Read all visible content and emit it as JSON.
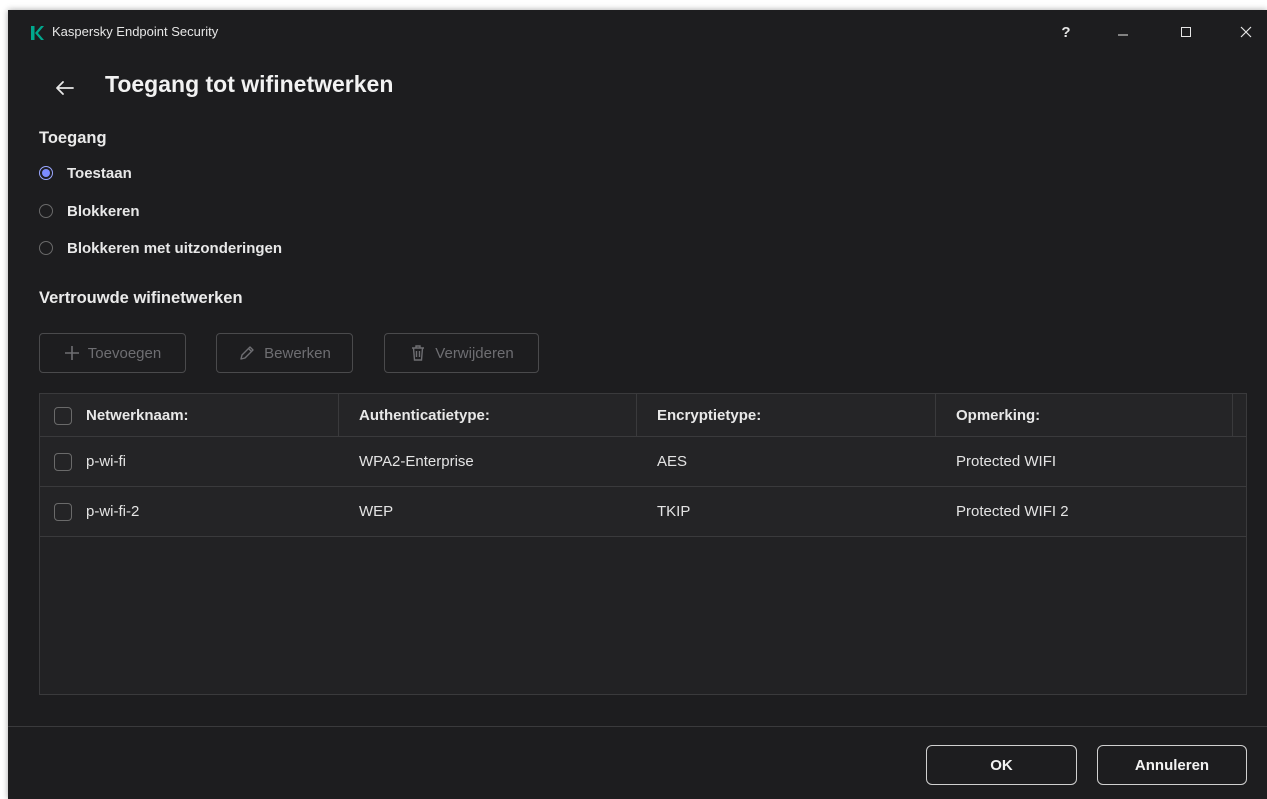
{
  "window": {
    "title": "Kaspersky Endpoint Security",
    "help_label": "?"
  },
  "page": {
    "title": "Toegang tot wifinetwerken"
  },
  "access": {
    "label": "Toegang",
    "options": [
      {
        "label": "Toestaan",
        "selected": true
      },
      {
        "label": "Blokkeren",
        "selected": false
      },
      {
        "label": "Blokkeren met uitzonderingen",
        "selected": false
      }
    ]
  },
  "trusted": {
    "label": "Vertrouwde wifinetwerken",
    "toolbar": {
      "add_label": "Toevoegen",
      "edit_label": "Bewerken",
      "delete_label": "Verwijderen"
    }
  },
  "table": {
    "columns": [
      "Netwerknaam:",
      "Authenticatietype:",
      "Encryptietype:",
      "Opmerking:"
    ],
    "rows": [
      [
        "p-wi-fi",
        "WPA2-Enterprise",
        "AES",
        "Protected WIFI"
      ],
      [
        "p-wi-fi-2",
        "WEP",
        "TKIP",
        "Protected WIFI 2"
      ]
    ]
  },
  "footer": {
    "ok_label": "OK",
    "cancel_label": "Annuleren"
  },
  "colors": {
    "background": "#1d1d1f",
    "accent": "#7c8cff",
    "logo": "#00a88e"
  },
  "icons": {
    "logo": "kaspersky-k-icon",
    "back": "arrow-left-icon",
    "add": "plus-icon",
    "edit": "pencil-icon",
    "delete": "trash-icon"
  }
}
